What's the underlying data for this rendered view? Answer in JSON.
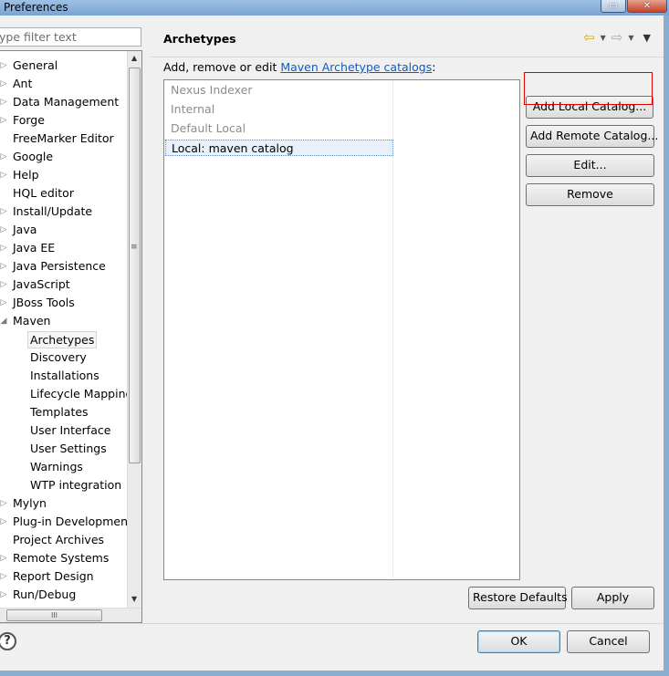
{
  "window": {
    "title": "Preferences",
    "controls": [
      "▭",
      "✕"
    ]
  },
  "left": {
    "filter_placeholder": "ype filter text",
    "tree": [
      {
        "label": "General",
        "arrow": "▷",
        "level": 0
      },
      {
        "label": "Ant",
        "arrow": "▷",
        "level": 0
      },
      {
        "label": "Data Management",
        "arrow": "▷",
        "level": 0
      },
      {
        "label": "Forge",
        "arrow": "▷",
        "level": 0
      },
      {
        "label": "FreeMarker Editor",
        "arrow": "",
        "level": 0
      },
      {
        "label": "Google",
        "arrow": "▷",
        "level": 0
      },
      {
        "label": "Help",
        "arrow": "▷",
        "level": 0
      },
      {
        "label": "HQL editor",
        "arrow": "",
        "level": 0
      },
      {
        "label": "Install/Update",
        "arrow": "▷",
        "level": 0
      },
      {
        "label": "Java",
        "arrow": "▷",
        "level": 0
      },
      {
        "label": "Java EE",
        "arrow": "▷",
        "level": 0
      },
      {
        "label": "Java Persistence",
        "arrow": "▷",
        "level": 0
      },
      {
        "label": "JavaScript",
        "arrow": "▷",
        "level": 0
      },
      {
        "label": "JBoss Tools",
        "arrow": "▷",
        "level": 0
      },
      {
        "label": "Maven",
        "arrow": "◢",
        "level": 0
      },
      {
        "label": "Archetypes",
        "arrow": "",
        "level": 1,
        "selected": true
      },
      {
        "label": "Discovery",
        "arrow": "",
        "level": 1
      },
      {
        "label": "Installations",
        "arrow": "",
        "level": 1
      },
      {
        "label": "Lifecycle Mapping",
        "arrow": "",
        "level": 1
      },
      {
        "label": "Templates",
        "arrow": "",
        "level": 1
      },
      {
        "label": "User Interface",
        "arrow": "",
        "level": 1
      },
      {
        "label": "User Settings",
        "arrow": "",
        "level": 1
      },
      {
        "label": "Warnings",
        "arrow": "",
        "level": 1
      },
      {
        "label": "WTP integration",
        "arrow": "",
        "level": 1
      },
      {
        "label": "Mylyn",
        "arrow": "▷",
        "level": 0
      },
      {
        "label": "Plug-in Development",
        "arrow": "▷",
        "level": 0
      },
      {
        "label": "Project Archives",
        "arrow": "",
        "level": 0
      },
      {
        "label": "Remote Systems",
        "arrow": "▷",
        "level": 0
      },
      {
        "label": "Report Design",
        "arrow": "▷",
        "level": 0
      },
      {
        "label": "Run/Debug",
        "arrow": "▷",
        "level": 0
      }
    ]
  },
  "page": {
    "title": "Archetypes",
    "intro_prefix": "Add, remove or edit ",
    "intro_link": "Maven Archetype catalogs",
    "intro_suffix": ":",
    "catalogs": [
      {
        "label": "Nexus Indexer",
        "active": false
      },
      {
        "label": "Internal",
        "active": false
      },
      {
        "label": "Default Local",
        "active": false
      },
      {
        "label": "Local: maven catalog",
        "active": true
      }
    ],
    "buttons": {
      "add_local": "Add Local Catalog...",
      "add_remote": "Add Remote Catalog...",
      "edit": "Edit...",
      "remove": "Remove",
      "restore": "Restore Defaults",
      "apply": "Apply"
    }
  },
  "footer": {
    "ok": "OK",
    "cancel": "Cancel",
    "help": "?"
  }
}
